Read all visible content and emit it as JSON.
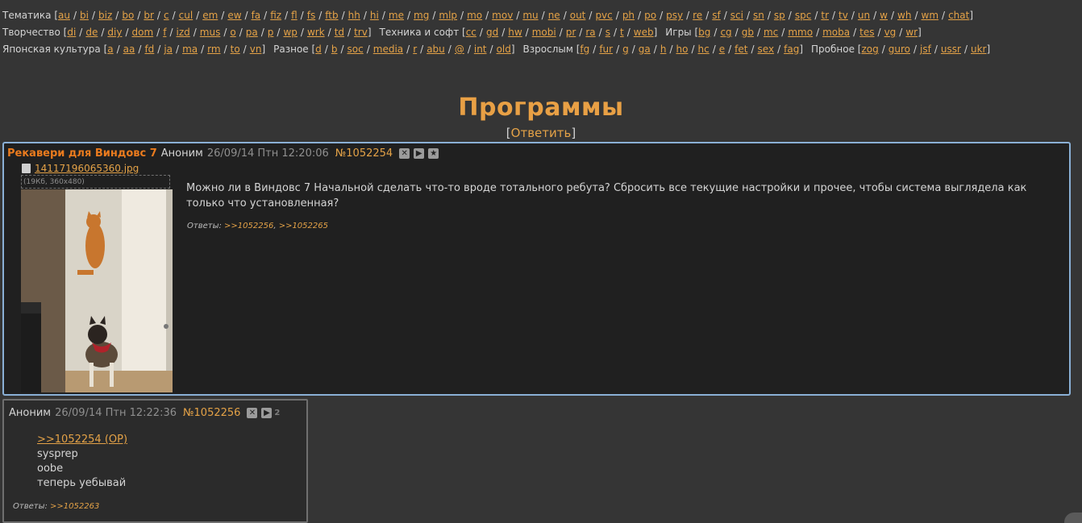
{
  "nav": {
    "rows": [
      [
        {
          "name": "Тематика",
          "boards": [
            "au",
            "bi",
            "biz",
            "bo",
            "br",
            "c",
            "cul",
            "em",
            "ew",
            "fa",
            "fiz",
            "fl",
            "fs",
            "ftb",
            "hh",
            "hi",
            "me",
            "mg",
            "mlp",
            "mo",
            "mov",
            "mu",
            "ne",
            "out",
            "pvc",
            "ph",
            "po",
            "psy",
            "re",
            "sf",
            "sci",
            "sn",
            "sp",
            "spc",
            "tr",
            "tv",
            "un",
            "w",
            "wh",
            "wm",
            "chat"
          ]
        }
      ],
      [
        {
          "name": "Творчество",
          "boards": [
            "di",
            "de",
            "diy",
            "dom",
            "f",
            "izd",
            "mus",
            "o",
            "pa",
            "p",
            "wp",
            "wrk",
            "td",
            "trv"
          ]
        },
        {
          "name": "Техника и софт",
          "boards": [
            "cc",
            "gd",
            "hw",
            "mobi",
            "pr",
            "ra",
            "s",
            "t",
            "web"
          ]
        },
        {
          "name": "Игры",
          "boards": [
            "bg",
            "cg",
            "gb",
            "mc",
            "mmo",
            "moba",
            "tes",
            "vg",
            "wr"
          ]
        }
      ],
      [
        {
          "name": "Японская культура",
          "boards": [
            "a",
            "aa",
            "fd",
            "ja",
            "ma",
            "rm",
            "to",
            "vn"
          ]
        },
        {
          "name": "Разное",
          "boards": [
            "d",
            "b",
            "soc",
            "media",
            "r",
            "abu",
            "@",
            "int",
            "old"
          ]
        },
        {
          "name": "Взрослым",
          "boards": [
            "fg",
            "fur",
            "g",
            "ga",
            "h",
            "ho",
            "hc",
            "e",
            "fet",
            "sex",
            "fag"
          ]
        },
        {
          "name": "Пробное",
          "boards": [
            "zog",
            "guro",
            "jsf",
            "ussr",
            "ukr"
          ]
        }
      ]
    ]
  },
  "board": {
    "title": "Программы",
    "reply_link": "Ответить"
  },
  "op": {
    "subject": "Рекавери для Виндовс 7",
    "author": "Аноним",
    "date": "26/09/14 Птн 12:20:06",
    "number": "№1052254",
    "file_name": "14117196065360.jpg",
    "file_meta": "(19Кб, 360x480)",
    "text": "Можно ли в Виндовс 7 Начальной сделать что-то вроде тотального ребута? Сбросить все текущие настройки и прочее, чтобы система выглядела как только что установленная?",
    "replies_label": "Ответы:",
    "replies": [
      ">>1052256",
      ">>1052265"
    ]
  },
  "reply": {
    "author": "Аноним",
    "date": "26/09/14 Птн 12:22:36",
    "number": "№1052256",
    "count": "2",
    "quote": ">>1052254 (OP)",
    "lines": [
      "sysprep",
      "oobe",
      "теперь уебывай"
    ],
    "replies_label": "Ответы:",
    "replies": [
      ">>1052263"
    ]
  }
}
